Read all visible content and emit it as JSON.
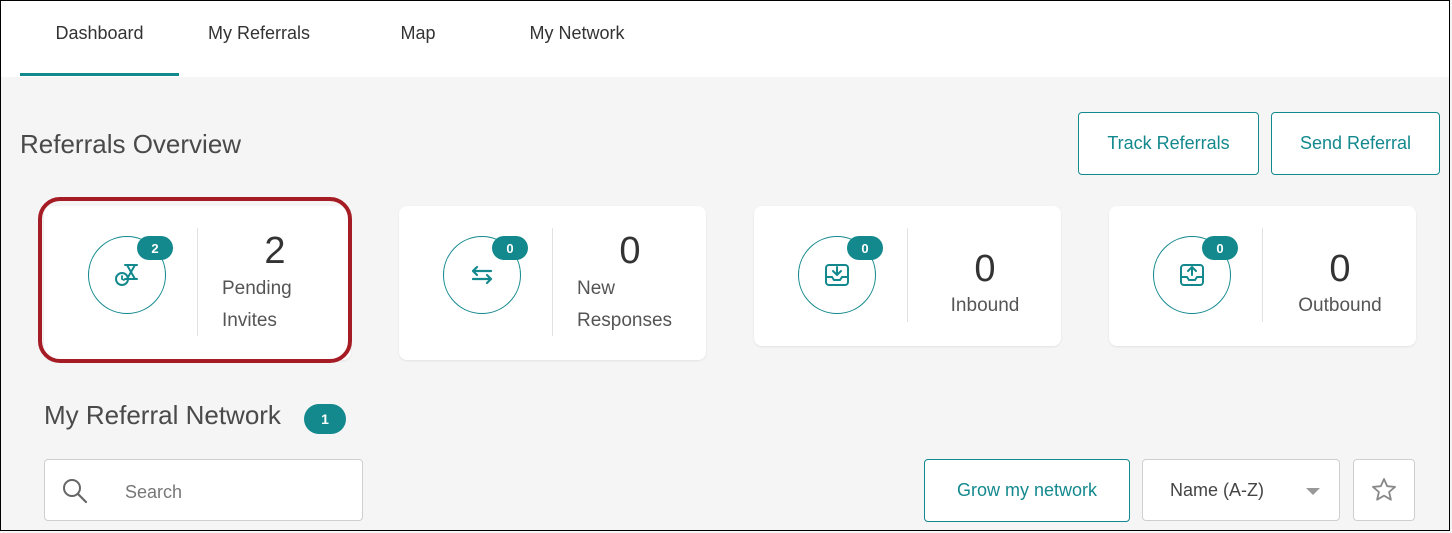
{
  "nav": {
    "tabs": [
      {
        "label": "Dashboard",
        "active": true
      },
      {
        "label": "My Referrals"
      },
      {
        "label": "Map"
      },
      {
        "label": "My Network"
      }
    ]
  },
  "overview": {
    "title": "Referrals Overview",
    "track_label": "Track Referrals",
    "send_label": "Send Referral"
  },
  "cards": [
    {
      "badge": "2",
      "value": "2",
      "label_line1": "Pending",
      "label_line2": "Invites",
      "icon": "pending-invites-icon"
    },
    {
      "badge": "0",
      "value": "0",
      "label_line1": "New",
      "label_line2": "Responses",
      "icon": "exchange-arrows-icon"
    },
    {
      "badge": "0",
      "value": "0",
      "label": "Inbound",
      "icon": "inbox-download-icon"
    },
    {
      "badge": "0",
      "value": "0",
      "label": "Outbound",
      "icon": "outbox-upload-icon"
    }
  ],
  "network": {
    "title": "My Referral Network",
    "count": "1",
    "search_placeholder": "Search",
    "grow_label": "Grow my network",
    "sort_value": "Name (A-Z)"
  },
  "colors": {
    "accent": "#13898e",
    "highlight": "#a51c24"
  }
}
